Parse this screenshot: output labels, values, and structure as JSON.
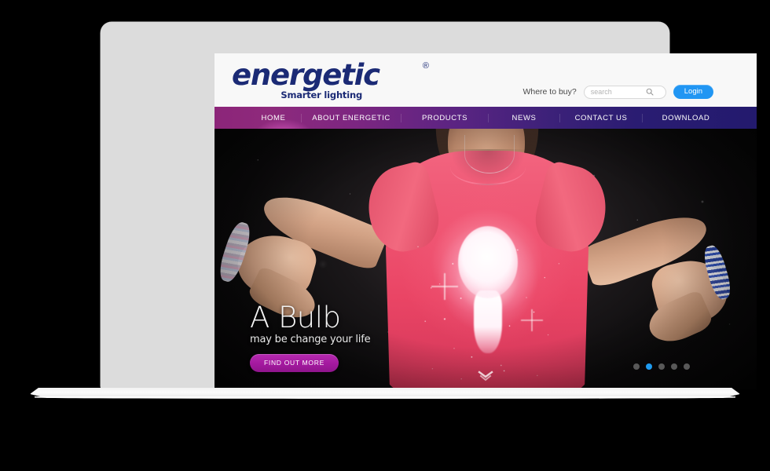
{
  "brand": {
    "wordmark": "energetic",
    "trademark": "®",
    "tagline": "Smarter lighting"
  },
  "header": {
    "where_to_buy_label": "Where to buy?",
    "search_placeholder": "search",
    "search_value": "",
    "search_icon": "search-icon",
    "login_label": "Login"
  },
  "nav": {
    "items": [
      {
        "label": "HOME",
        "active": true
      },
      {
        "label": "ABOUT ENERGETIC",
        "active": false
      },
      {
        "label": "PRODUCTS",
        "active": false
      },
      {
        "label": "NEWS",
        "active": false
      },
      {
        "label": "CONTACT US",
        "active": false
      },
      {
        "label": "DOWNLOAD",
        "active": false
      }
    ]
  },
  "hero": {
    "title": "A Bulb",
    "subtitle": "may be change your life",
    "cta_label": "FIND OUT MORE",
    "scroll_icon": "chevron-down-icon",
    "carousel": {
      "total": 5,
      "active_index": 1
    }
  },
  "colors": {
    "brand_navy": "#1b2a75",
    "nav_gradient_start": "#8c2579",
    "nav_gradient_end": "#231a6e",
    "login_blue": "#2196f3",
    "cta_magenta": "#a4199f",
    "dot_active": "#1e9bf0",
    "dot_inactive": "#585858",
    "bezel_gray": "#dcdcdc",
    "page_background": "#000000"
  }
}
